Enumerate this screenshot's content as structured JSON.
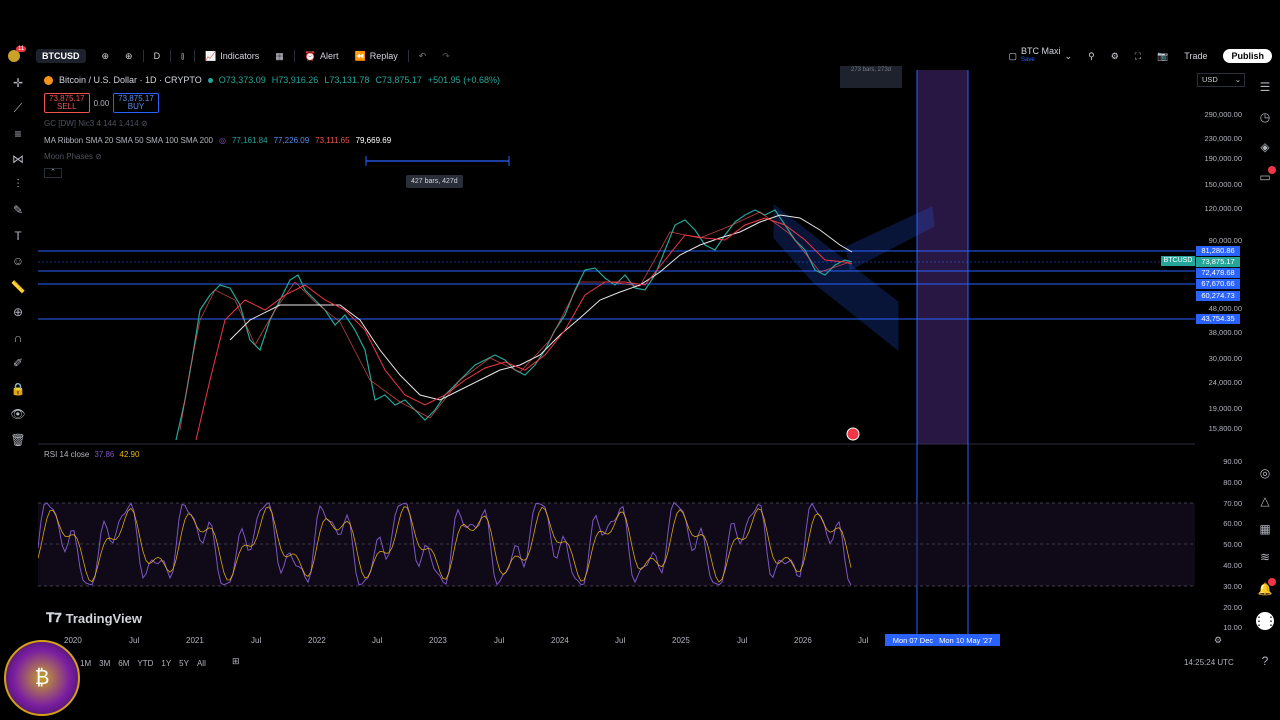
{
  "toolbar": {
    "symbol": "BTCUSD",
    "interval": "D",
    "indicators": "Indicators",
    "alert": "Alert",
    "replay": "Replay",
    "layout_name": "BTC Maxi",
    "layout_sub": "Save",
    "trade": "Trade",
    "publish": "Publish",
    "notification_count": "11"
  },
  "legend": {
    "title": "Bitcoin / U.S. Dollar · 1D · CRYPTO",
    "open": "O73,373.09",
    "high": "H73,916.26",
    "low": "L73,131.78",
    "close": "C73,875.17",
    "change": "+501.95 (+0.68%)",
    "sell_price": "73,875.17",
    "sell_label": "SELL",
    "spread": "0.00",
    "buy_price": "73,875.17",
    "buy_label": "BUY",
    "gc_line": "GC [DW] Nic3 4 144 1.414",
    "ma_ribbon": "MA Ribbon SMA 20 SMA 50 SMA 100 SMA 200",
    "ma_v1": "77,161.84",
    "ma_v2": "77,226.09",
    "ma_v3": "73,111.65",
    "ma_v4": "79,669.69",
    "moon": "Moon Phases"
  },
  "currency": "USD",
  "measure_tooltip": "427 bars, 427d",
  "top_tooltip": "273 bars, 273d",
  "rsi": {
    "label": "RSI 14 close",
    "v1": "37.86",
    "v2": "42.90"
  },
  "price_axis": [
    "290,000.00",
    "230,000.00",
    "190,000.00",
    "150,000.00",
    "120,000.00",
    "90,000.00",
    "48,000.00",
    "38,000.00",
    "30,000.00",
    "24,000.00",
    "19,000.00",
    "15,800.00"
  ],
  "price_labels": [
    {
      "value": "81,280.86",
      "color": "#2962ff"
    },
    {
      "value": "73,875.17",
      "color": "#26a69a"
    },
    {
      "value": "72,478.68",
      "color": "#2962ff"
    },
    {
      "value": "67,670.66",
      "color": "#2962ff"
    },
    {
      "value": "60,274.73",
      "color": "#2962ff"
    },
    {
      "value": "43,754.35",
      "color": "#2962ff"
    }
  ],
  "symbol_flag": "BTCUSD",
  "rsi_axis": [
    "90.00",
    "80.00",
    "70.00",
    "60.00",
    "50.00",
    "40.00",
    "30.00",
    "20.00",
    "10.00"
  ],
  "time_axis": [
    "2020",
    "Jul",
    "2021",
    "Jul",
    "2022",
    "Jul",
    "2023",
    "Jul",
    "2024",
    "Jul",
    "2025",
    "Jul",
    "2026",
    "Jul"
  ],
  "date_range": {
    "start": "Mon 07 Dec",
    "end": "Mon 10 May '27"
  },
  "ranges": [
    "1M",
    "3M",
    "6M",
    "YTD",
    "1Y",
    "5Y",
    "All"
  ],
  "clock": "14:25:24 UTC",
  "brand": "TradingView"
}
